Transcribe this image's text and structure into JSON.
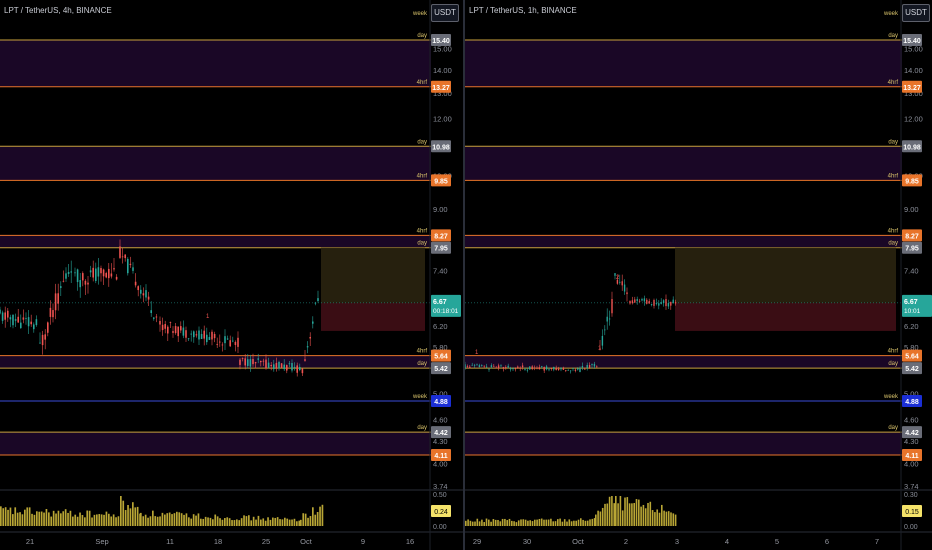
{
  "charts": [
    {
      "title": "LPT / TetherUS, 4h, BINANCE",
      "currency": "USDT",
      "price_ticks": [
        "15.00",
        "14.00",
        "13.00",
        "12.00",
        "11.00",
        "10.00",
        "9.00",
        "8.00",
        "7.40",
        "6.80",
        "6.20",
        "5.80",
        "5.40",
        "5.00",
        "4.60",
        "4.30",
        "4.00",
        "3.74"
      ],
      "date_labels": [
        "21",
        "Sep",
        "11",
        "18",
        "25",
        "Oct",
        "9",
        "16"
      ],
      "volume_ticks": [
        "0.50",
        "0.00"
      ],
      "levels": [
        {
          "tag": "day",
          "price": "15.40",
          "color": "#c8a23c",
          "badge": "#6a6d78"
        },
        {
          "tag": "4hrf",
          "price": "13.27",
          "color": "#e8742a",
          "badge": "#e8742a"
        },
        {
          "tag": "day",
          "price": "10.98",
          "color": "#c8a23c",
          "badge": "#6a6d78"
        },
        {
          "tag": "4hrf",
          "price": "9.85",
          "color": "#e8742a",
          "badge": "#e8742a"
        },
        {
          "tag": "4hrf",
          "price": "8.27",
          "color": "#e8742a",
          "badge": "#e8742a"
        },
        {
          "tag": "day",
          "price": "7.95",
          "color": "#c8a23c",
          "badge": "#6a6d78"
        },
        {
          "tag": "4hrf",
          "price": "5.64",
          "color": "#e8742a",
          "badge": "#e8742a"
        },
        {
          "tag": "day",
          "price": "5.42",
          "color": "#c8a23c",
          "badge": "#6a6d78"
        },
        {
          "tag": "week",
          "price": "4.88",
          "color": "#3a4bd8",
          "badge": "#1b2fd6"
        },
        {
          "tag": "day",
          "price": "4.42",
          "color": "#c8a23c",
          "badge": "#6a6d78"
        },
        {
          "tag": "",
          "price": "4.11",
          "color": "#e8742a",
          "badge": "#e8742a"
        }
      ],
      "week_tag": "week",
      "last_price": "6.67",
      "countdown": "00:18:01",
      "last_volume": "0.24",
      "wave_labels": [
        "1"
      ]
    },
    {
      "title": "LPT / TetherUS, 1h, BINANCE",
      "currency": "USDT",
      "price_ticks": [
        "15.00",
        "14.00",
        "13.00",
        "12.00",
        "11.00",
        "10.00",
        "9.00",
        "8.00",
        "7.40",
        "6.80",
        "6.20",
        "5.80",
        "5.40",
        "5.00",
        "4.60",
        "4.30",
        "4.00",
        "3.74"
      ],
      "date_labels": [
        "29",
        "30",
        "Oct",
        "2",
        "3",
        "4",
        "5",
        "6",
        "7"
      ],
      "volume_ticks": [
        "0.30",
        "0.00"
      ],
      "levels": [
        {
          "tag": "day",
          "price": "15.40",
          "color": "#c8a23c",
          "badge": "#6a6d78"
        },
        {
          "tag": "4hrf",
          "price": "13.27",
          "color": "#e8742a",
          "badge": "#e8742a"
        },
        {
          "tag": "day",
          "price": "10.98",
          "color": "#c8a23c",
          "badge": "#6a6d78"
        },
        {
          "tag": "4hrf",
          "price": "9.85",
          "color": "#e8742a",
          "badge": "#e8742a"
        },
        {
          "tag": "4hrf",
          "price": "8.27",
          "color": "#e8742a",
          "badge": "#e8742a"
        },
        {
          "tag": "day",
          "price": "7.95",
          "color": "#c8a23c",
          "badge": "#6a6d78"
        },
        {
          "tag": "4hrf",
          "price": "5.64",
          "color": "#e8742a",
          "badge": "#e8742a"
        },
        {
          "tag": "day",
          "price": "5.42",
          "color": "#c8a23c",
          "badge": "#6a6d78"
        },
        {
          "tag": "week",
          "price": "4.88",
          "color": "#3a4bd8",
          "badge": "#1b2fd6"
        },
        {
          "tag": "day",
          "price": "4.42",
          "color": "#c8a23c",
          "badge": "#6a6d78"
        },
        {
          "tag": "",
          "price": "4.11",
          "color": "#e8742a",
          "badge": "#e8742a"
        }
      ],
      "week_tag": "week",
      "last_price": "6.67",
      "countdown": "10:01",
      "last_volume": "0.15",
      "wave_labels": [
        "1",
        "2",
        "1"
      ]
    }
  ],
  "chart_data": [
    {
      "type": "candlestick",
      "title": "LPT / TetherUS, 4h, BINANCE",
      "x": [
        "21",
        "Sep",
        "11",
        "18",
        "25",
        "Oct"
      ],
      "close": [
        6.6,
        7.3,
        7.5,
        7.4,
        6.4,
        6.2,
        5.8,
        5.5,
        5.45,
        6.67
      ],
      "ylim": [
        3.74,
        15.4
      ],
      "scale": "log",
      "zones": [
        [
          13.27,
          15.4
        ],
        [
          9.85,
          10.98
        ],
        [
          7.95,
          8.27
        ],
        [
          5.42,
          5.64
        ],
        [
          4.11,
          4.42
        ]
      ],
      "position_box": {
        "entry": 6.67,
        "target": 7.95,
        "stop": 6.1
      }
    },
    {
      "type": "candlestick",
      "title": "LPT / TetherUS, 1h, BINANCE",
      "x": [
        "29",
        "30",
        "Oct",
        "2",
        "3"
      ],
      "close": [
        5.45,
        5.45,
        5.4,
        5.5,
        7.0,
        6.67
      ],
      "ylim": [
        3.74,
        15.4
      ],
      "scale": "log",
      "zones": [
        [
          13.27,
          15.4
        ],
        [
          9.85,
          10.98
        ],
        [
          7.95,
          8.27
        ],
        [
          5.42,
          5.64
        ],
        [
          4.11,
          4.42
        ]
      ],
      "position_box": {
        "entry": 6.67,
        "target": 7.95,
        "stop": 6.1
      }
    }
  ]
}
